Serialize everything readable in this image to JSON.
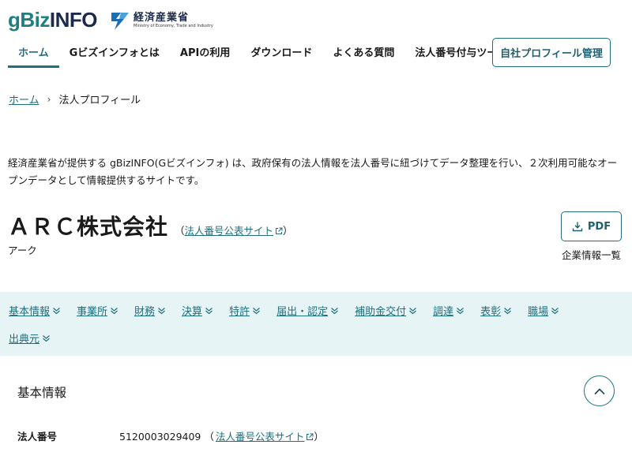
{
  "header": {
    "logo_g": "g",
    "logo_biz": "Biz",
    "logo_info": "INFO",
    "ministry_jp": "経済産業省",
    "ministry_en": "Ministry of Economy, Trade and Industry",
    "nav": [
      {
        "label": "ホーム",
        "active": true
      },
      {
        "label": "Gビズインフォとは"
      },
      {
        "label": "APIの利用"
      },
      {
        "label": "ダウンロード"
      },
      {
        "label": "よくある質問"
      },
      {
        "label": "法人番号付与ツール"
      }
    ],
    "profile_button": "自社プロフィール管理"
  },
  "breadcrumb": {
    "home": "ホーム",
    "separator": "›",
    "current": "法人プロフィール"
  },
  "intro": "経済産業省が提供する gBizINFO(Gビズインフォ) は、政府保有の法人情報を法人番号に紐づけてデータ整理を行い、２次利用可能なオープンデータとして情報提供するサイトです。",
  "company": {
    "name": "ＡＲＣ株式会社",
    "paren_open": "（",
    "paren_close": "）",
    "corp_site_link": "法人番号公表サイト",
    "kana": "アーク"
  },
  "pdf": {
    "label": "PDF",
    "caption": "企業情報一覧"
  },
  "tabs_row1": [
    "基本情報",
    "事業所",
    "財務",
    "決算",
    "特許",
    "届出・認定",
    "補助金交付",
    "調達",
    "表彰",
    "職場"
  ],
  "tabs_row2": [
    "出典元"
  ],
  "section": {
    "title": "基本情報",
    "rows": [
      {
        "label": "法人番号",
        "value": "5120003029409",
        "paren_open": "（",
        "link": "法人番号公表サイト",
        "paren_close": "）"
      }
    ]
  },
  "colors": {
    "accent": "#1f6f7f",
    "tab_bg": "#e7f4f6",
    "logo_teal": "#1f7f7f",
    "logo_navy": "#1c2a4a"
  }
}
